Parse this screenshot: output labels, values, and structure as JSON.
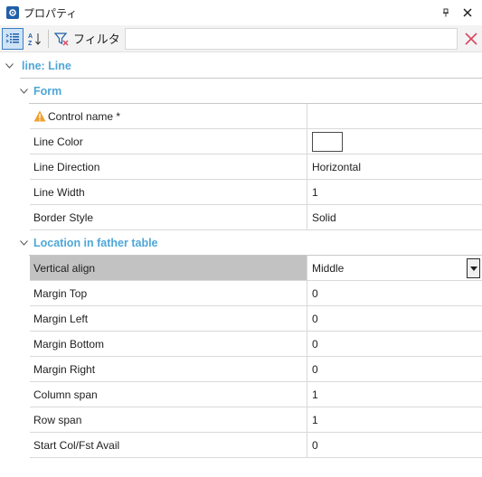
{
  "panel": {
    "title": "プロパティ"
  },
  "toolbar": {
    "filter_label": "フィルタ",
    "filter_value": "",
    "filter_placeholder": ""
  },
  "root_group": {
    "title": "line: Line"
  },
  "groups": [
    {
      "title": "Form",
      "rows": [
        {
          "name": "Control name *",
          "value": "",
          "warning": true
        },
        {
          "name": "Line Color",
          "value": "",
          "swatch": "#ffffff"
        },
        {
          "name": "Line Direction",
          "value": "Horizontal"
        },
        {
          "name": "Line Width",
          "value": "1"
        },
        {
          "name": "Border Style",
          "value": "Solid"
        }
      ]
    },
    {
      "title": "Location in father table",
      "rows": [
        {
          "name": "Vertical align",
          "value": "Middle",
          "selected": true,
          "dropdown": true
        },
        {
          "name": "Margin Top",
          "value": "0"
        },
        {
          "name": "Margin Left",
          "value": "0"
        },
        {
          "name": "Margin Bottom",
          "value": "0"
        },
        {
          "name": "Margin Right",
          "value": "0"
        },
        {
          "name": "Column span",
          "value": "1"
        },
        {
          "name": "Row span",
          "value": "1"
        },
        {
          "name": "Start Col/Fst Avail",
          "value": "0"
        }
      ]
    }
  ],
  "colors": {
    "group_title": "#4ea7d8",
    "selected_row": "#c2c2c2",
    "clear_icon": "#d9455f",
    "warning": "#f0a030"
  }
}
